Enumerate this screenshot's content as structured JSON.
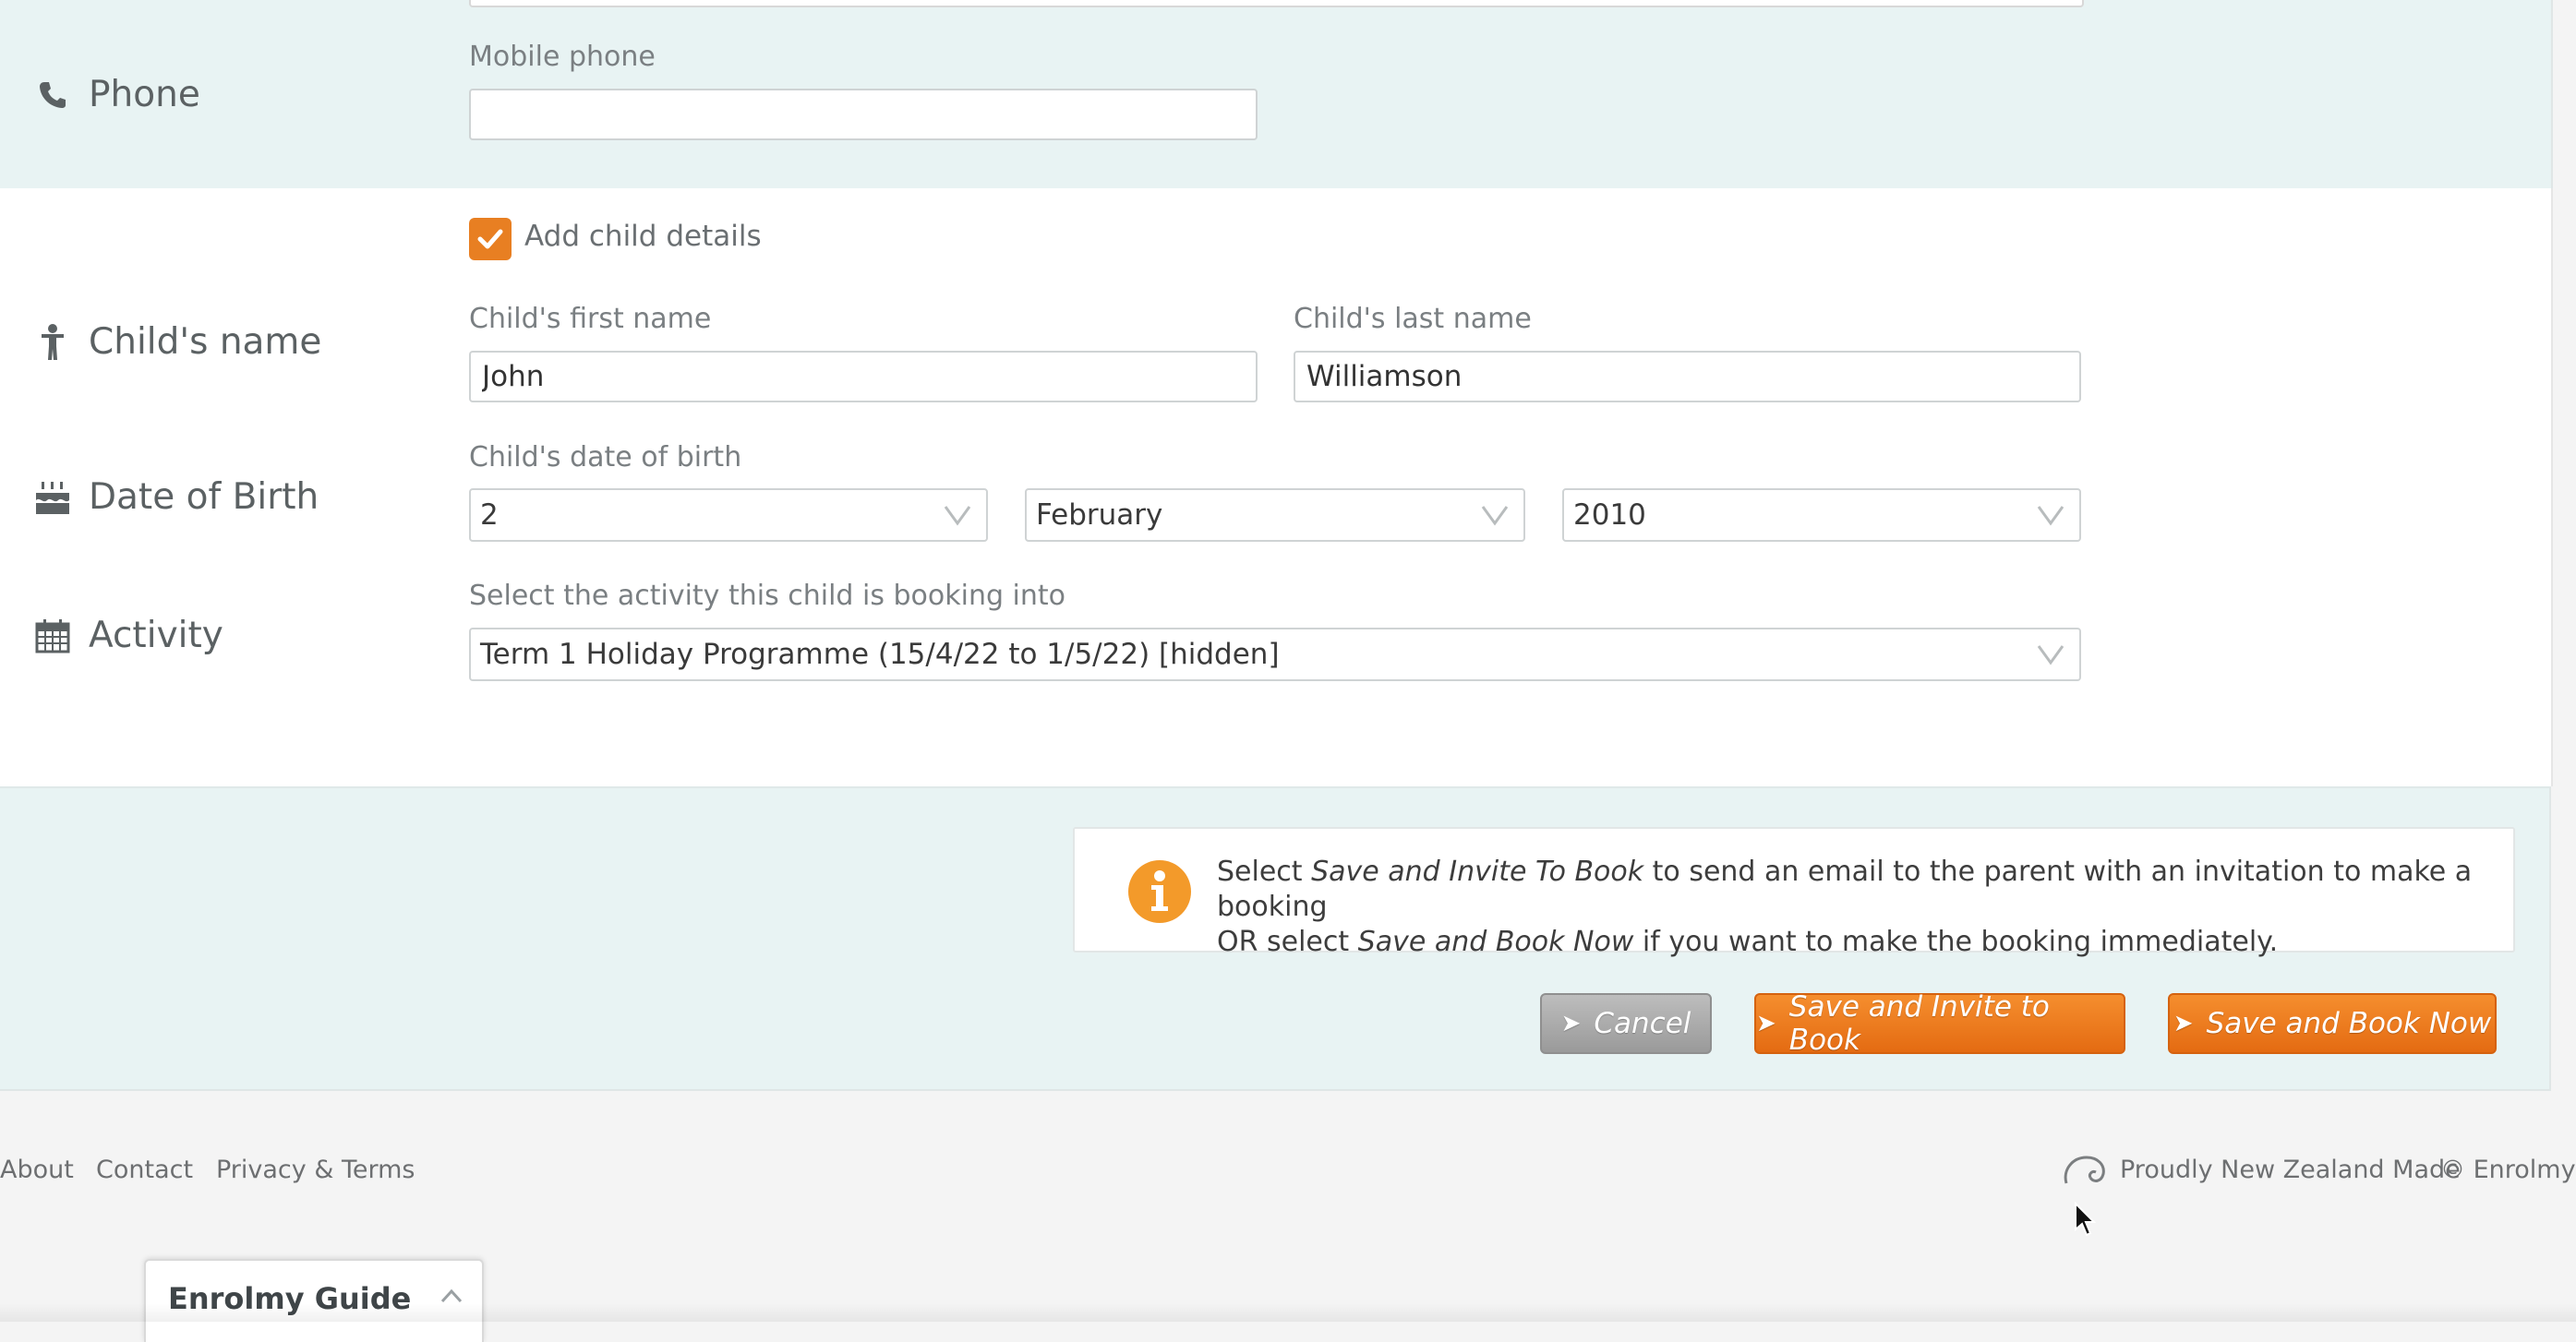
{
  "phone": {
    "label": "Phone",
    "mobile_label": "Mobile phone",
    "mobile_value": ""
  },
  "child": {
    "checkbox_label": "Add child details",
    "checkbox_checked": true,
    "name_row_label": "Child's name",
    "first_name_label": "Child's first name",
    "first_name_value": "John",
    "last_name_label": "Child's last name",
    "last_name_value": "Williamson",
    "dob_row_label": "Date of Birth",
    "dob_label": "Child's date of birth",
    "dob_day": "2",
    "dob_month": "February",
    "dob_year": "2010",
    "activity_row_label": "Activity",
    "activity_label": "Select the activity this child is booking into",
    "activity_value": "Term 1 Holiday Programme (15/4/22 to 1/5/22) [hidden]"
  },
  "info": {
    "line1_prefix": "Select ",
    "line1_em": "Save and Invite To Book",
    "line1_suffix": " to send an email to the parent with an invitation to make a booking",
    "line2_prefix": "OR select ",
    "line2_em": "Save and Book Now",
    "line2_suffix": " if you want to make the booking immediately."
  },
  "buttons": {
    "cancel": "Cancel",
    "invite": "Save and Invite to Book",
    "book": "Save and Book Now"
  },
  "footer": {
    "about": "About",
    "contact": "Contact",
    "privacy": "Privacy & Terms",
    "nz_made": "Proudly New Zealand Made",
    "copyright": "© Enrolmy"
  },
  "guide": {
    "title": "Enrolmy Guide"
  },
  "colors": {
    "accent_orange": "#e87f22",
    "band_teal": "#e8f3f3",
    "cancel_grey": "#a8a8a8"
  }
}
